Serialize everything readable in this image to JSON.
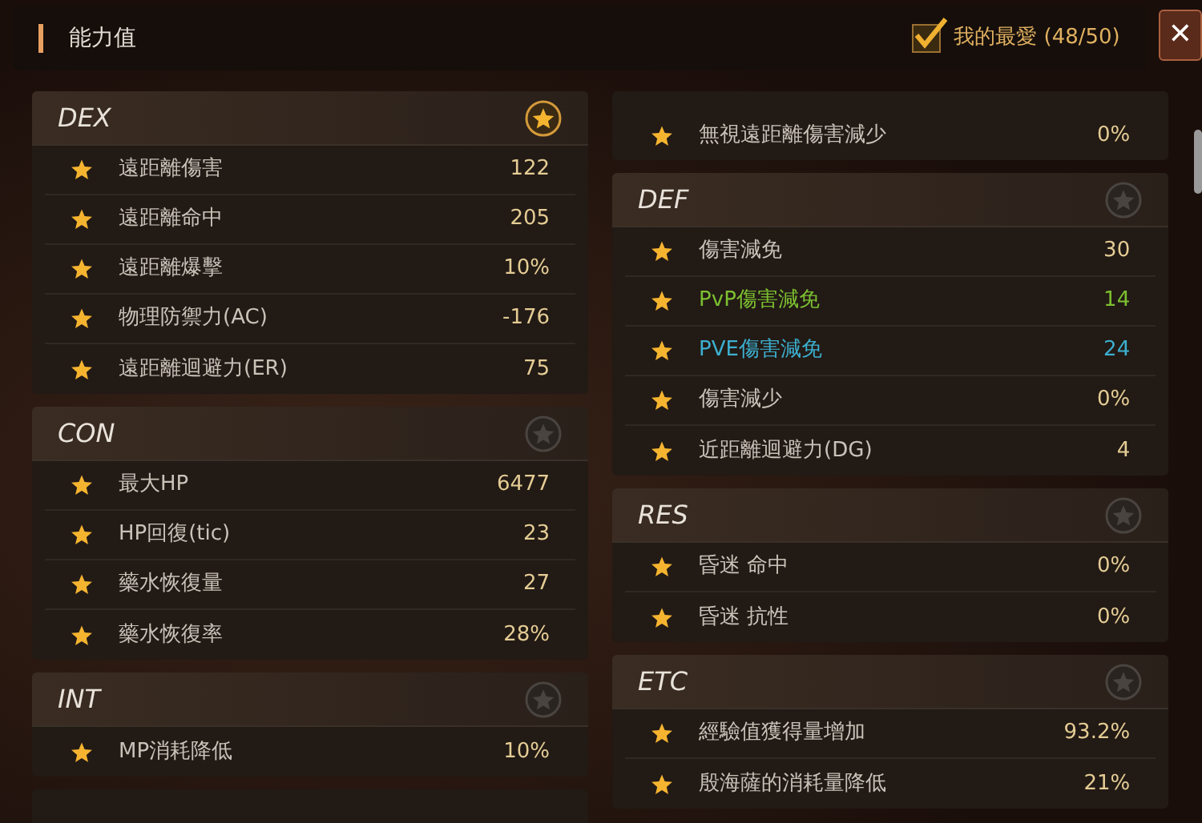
{
  "window": {
    "title": "能力值",
    "favorite": {
      "label": "我的最愛 (48/50)",
      "checked": true
    },
    "close": "✕"
  },
  "columns": [
    [
      {
        "name": "DEX",
        "favorite": true,
        "stats": [
          {
            "label": "遠距離傷害",
            "value": "122",
            "starred": true,
            "kind": "normal"
          },
          {
            "label": "遠距離命中",
            "value": "205",
            "starred": true,
            "kind": "normal"
          },
          {
            "label": "遠距離爆擊",
            "value": "10%",
            "starred": true,
            "kind": "normal"
          },
          {
            "label": "物理防禦力(AC)",
            "value": "-176",
            "starred": true,
            "kind": "normal"
          },
          {
            "label": "遠距離迴避力(ER)",
            "value": "75",
            "starred": true,
            "kind": "normal"
          }
        ]
      },
      {
        "name": "CON",
        "favorite": false,
        "stats": [
          {
            "label": "最大HP",
            "value": "6477",
            "starred": true,
            "kind": "normal"
          },
          {
            "label": "HP回復(tic)",
            "value": "23",
            "starred": true,
            "kind": "normal"
          },
          {
            "label": "藥水恢復量",
            "value": "27",
            "starred": true,
            "kind": "normal"
          },
          {
            "label": "藥水恢復率",
            "value": "28%",
            "starred": true,
            "kind": "normal"
          }
        ]
      },
      {
        "name": "INT",
        "favorite": false,
        "stats": [
          {
            "label": "MP消耗降低",
            "value": "10%",
            "starred": true,
            "kind": "normal"
          }
        ]
      }
    ],
    [
      {
        "stats": [
          {
            "label": "無視遠距離傷害減少",
            "value": "0%",
            "starred": true,
            "kind": "normal"
          }
        ]
      },
      {
        "name": "DEF",
        "favorite": false,
        "stats": [
          {
            "label": "傷害減免",
            "value": "30",
            "starred": true,
            "kind": "normal"
          },
          {
            "label": "PvP傷害減免",
            "value": "14",
            "starred": true,
            "kind": "pvp"
          },
          {
            "label": "PVE傷害減免",
            "value": "24",
            "starred": true,
            "kind": "pve"
          },
          {
            "label": "傷害減少",
            "value": "0%",
            "starred": true,
            "kind": "normal"
          },
          {
            "label": "近距離迴避力(DG)",
            "value": "4",
            "starred": true,
            "kind": "normal"
          }
        ]
      },
      {
        "name": "RES",
        "favorite": false,
        "stats": [
          {
            "label": "昏迷 命中",
            "value": "0%",
            "starred": true,
            "kind": "normal"
          },
          {
            "label": "昏迷 抗性",
            "value": "0%",
            "starred": true,
            "kind": "normal"
          }
        ]
      },
      {
        "name": "ETC",
        "favorite": false,
        "stats": [
          {
            "label": "經驗值獲得量增加",
            "value": "93.2%",
            "starred": true,
            "kind": "normal"
          },
          {
            "label": "殷海薩的消耗量降低",
            "value": "21%",
            "starred": true,
            "kind": "normal"
          }
        ]
      }
    ]
  ]
}
